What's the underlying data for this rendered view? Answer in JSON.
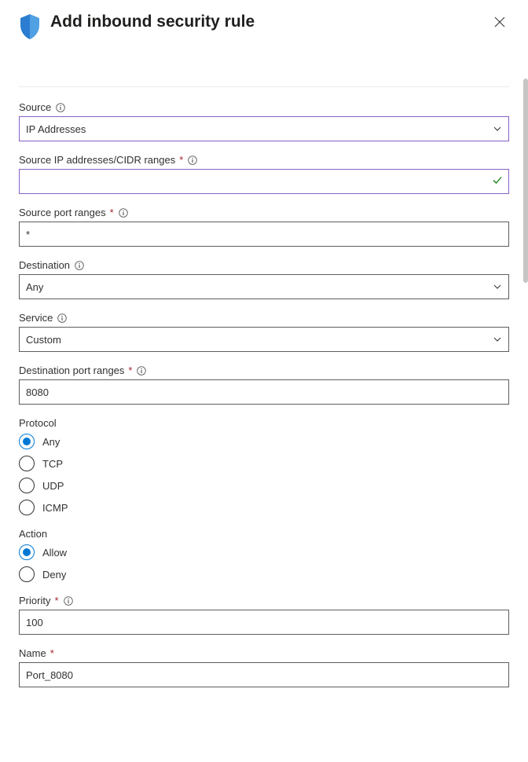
{
  "header": {
    "title": "Add inbound security rule"
  },
  "fields": {
    "source": {
      "label": "Source",
      "value": "IP Addresses"
    },
    "source_ip": {
      "label": "Source IP addresses/CIDR ranges",
      "value": ""
    },
    "source_port": {
      "label": "Source port ranges",
      "value": "*"
    },
    "destination": {
      "label": "Destination",
      "value": "Any"
    },
    "service": {
      "label": "Service",
      "value": "Custom"
    },
    "dest_port": {
      "label": "Destination port ranges",
      "value": "8080"
    },
    "protocol": {
      "label": "Protocol",
      "options": {
        "any": "Any",
        "tcp": "TCP",
        "udp": "UDP",
        "icmp": "ICMP"
      },
      "selected": "any"
    },
    "action": {
      "label": "Action",
      "options": {
        "allow": "Allow",
        "deny": "Deny"
      },
      "selected": "allow"
    },
    "priority": {
      "label": "Priority",
      "value": "100"
    },
    "name": {
      "label": "Name",
      "value": "Port_8080"
    }
  }
}
